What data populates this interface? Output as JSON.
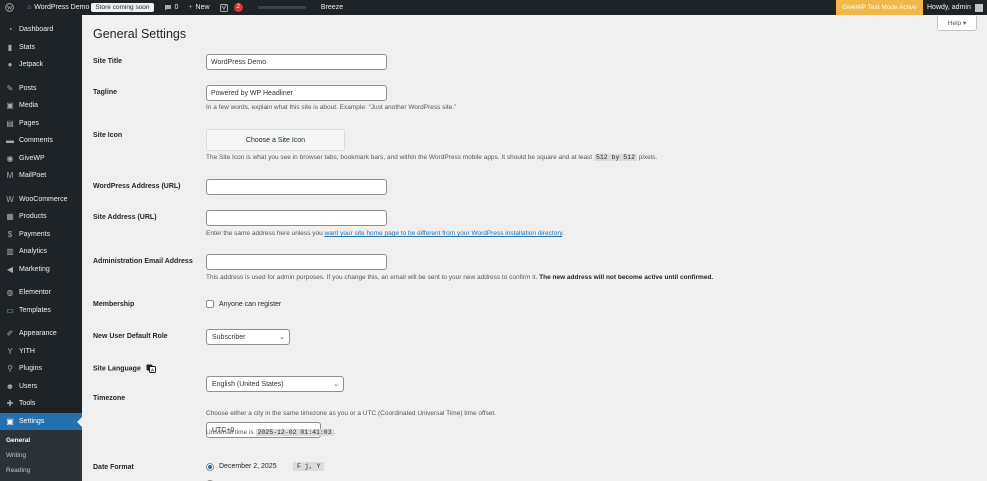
{
  "adminbar": {
    "site_name": "WordPress Demo",
    "store_badge": "Store coming soon",
    "comments_count": "0",
    "new_label": "New",
    "updates_count": "2",
    "breeze_label": "Breeze",
    "givewp_notice": "GiveWP Test Mode Active",
    "howdy": "Howdy, admin"
  },
  "sidebar": {
    "items": [
      {
        "label": "Dashboard",
        "icon": "dashboard-icon"
      },
      {
        "label": "Stats",
        "icon": "stats-icon"
      },
      {
        "label": "Jetpack",
        "icon": "jetpack-icon"
      },
      {
        "label": "Posts",
        "icon": "pin-icon"
      },
      {
        "label": "Media",
        "icon": "media-icon"
      },
      {
        "label": "Pages",
        "icon": "pages-icon"
      },
      {
        "label": "Comments",
        "icon": "comments-icon"
      },
      {
        "label": "GiveWP",
        "icon": "givewp-icon"
      },
      {
        "label": "MailPoet",
        "icon": "mailpoet-icon"
      },
      {
        "label": "WooCommerce",
        "icon": "woocommerce-icon"
      },
      {
        "label": "Products",
        "icon": "products-icon"
      },
      {
        "label": "Payments",
        "icon": "payments-icon"
      },
      {
        "label": "Analytics",
        "icon": "analytics-icon"
      },
      {
        "label": "Marketing",
        "icon": "marketing-icon"
      },
      {
        "label": "Elementor",
        "icon": "elementor-icon"
      },
      {
        "label": "Templates",
        "icon": "templates-icon"
      },
      {
        "label": "Appearance",
        "icon": "appearance-icon"
      },
      {
        "label": "YITH",
        "icon": "yith-icon"
      },
      {
        "label": "Plugins",
        "icon": "plugins-icon"
      },
      {
        "label": "Users",
        "icon": "users-icon"
      },
      {
        "label": "Tools",
        "icon": "tools-icon"
      },
      {
        "label": "Settings",
        "icon": "settings-icon"
      }
    ],
    "submenu": [
      "General",
      "Writing",
      "Reading"
    ]
  },
  "page": {
    "title": "General Settings",
    "help_label": "Help ▾"
  },
  "settings": {
    "site_title": {
      "label": "Site Title",
      "value": "WordPress Demo"
    },
    "tagline": {
      "label": "Tagline",
      "value": "Powered by WP Headliner",
      "desc": "In a few words, explain what this site is about. Example: “Just another WordPress site.”"
    },
    "site_icon": {
      "label": "Site Icon",
      "button": "Choose a Site Icon",
      "desc_before": "The Site Icon is what you see in browser tabs, bookmark bars, and within the WordPress mobile apps. It should be square and at least",
      "size_a": "512",
      "by": "by",
      "size_b": "512",
      "desc_after": "pixels."
    },
    "wp_address": {
      "label": "WordPress Address (URL)",
      "value": ""
    },
    "site_address": {
      "label": "Site Address (URL)",
      "value": "",
      "desc_before": "Enter the same address here unless you",
      "link": "want your site home page to be different from your WordPress installation directory",
      "desc_after": "."
    },
    "admin_email": {
      "label": "Administration Email Address",
      "value": "",
      "desc": "This address is used for admin purposes. If you change this, an email will be sent to your new address to confirm it.",
      "desc_bold": "The new address will not become active until confirmed."
    },
    "membership": {
      "label": "Membership",
      "checkbox_label": "Anyone can register"
    },
    "default_role": {
      "label": "New User Default Role",
      "value": "Subscriber"
    },
    "site_language": {
      "label": "Site Language",
      "value": "English (United States)"
    },
    "timezone": {
      "label": "Timezone",
      "value": "UTC+0",
      "desc": "Choose either a city in the same timezone as you or a UTC (Coordinated Universal Time) time offset.",
      "universal_label": "Universal time is",
      "universal_value": "2025-12-02 01:41:03",
      "universal_after": "."
    },
    "date_format": {
      "label": "Date Format",
      "option_1": "December 2, 2025",
      "option_1_code": "F j, Y"
    }
  }
}
